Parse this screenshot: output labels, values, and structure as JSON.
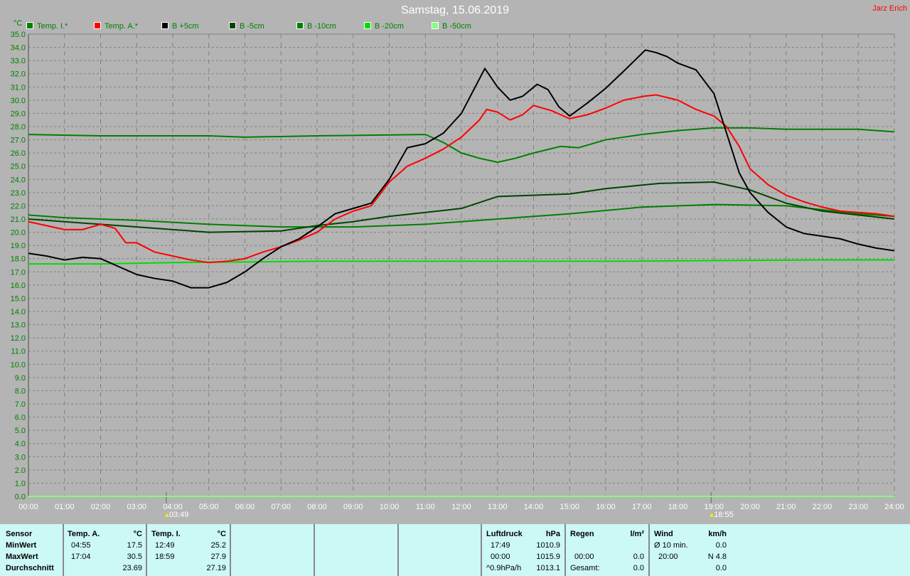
{
  "title": "Samstag, 15.06.2019",
  "author": "Jarz Erich",
  "chart_data": {
    "type": "line",
    "title": "Samstag, 15.06.2019",
    "ylabel": "°C",
    "xlabel": "",
    "ylim": [
      0,
      35
    ],
    "xlim": [
      0,
      24
    ],
    "yticks": [
      "0.0",
      "1.0",
      "2.0",
      "3.0",
      "4.0",
      "5.0",
      "6.0",
      "7.0",
      "8.0",
      "9.0",
      "10.0",
      "11.0",
      "12.0",
      "13.0",
      "14.0",
      "15.0",
      "16.0",
      "17.0",
      "18.0",
      "19.0",
      "20.0",
      "21.0",
      "22.0",
      "23.0",
      "24.0",
      "25.0",
      "26.0",
      "27.0",
      "28.0",
      "29.0",
      "30.0",
      "31.0",
      "32.0",
      "33.0",
      "34.0",
      "35.0"
    ],
    "xticks": [
      "00:00",
      "01:00",
      "02:00",
      "03:00",
      "04:00",
      "05:00",
      "06:00",
      "07:00",
      "08:00",
      "09:00",
      "10:00",
      "11:00",
      "12:00",
      "13:00",
      "14:00",
      "15:00",
      "16:00",
      "17:00",
      "18:00",
      "19:00",
      "20:00",
      "21:00",
      "22:00",
      "23:00",
      "24:00"
    ],
    "grid": true,
    "legend": "top-left",
    "annotations": [
      {
        "label": "03:49",
        "x": 3.82,
        "kind": "sunrise"
      },
      {
        "label": "18:55",
        "x": 18.92,
        "kind": "sunset"
      }
    ],
    "series": [
      {
        "name": "Temp. I.*",
        "color": "#008000",
        "points": [
          [
            0,
            27.4
          ],
          [
            2,
            27.3
          ],
          [
            5,
            27.3
          ],
          [
            6,
            27.2
          ],
          [
            8,
            27.3
          ],
          [
            11,
            27.4
          ],
          [
            11.5,
            26.8
          ],
          [
            12,
            26.0
          ],
          [
            12.5,
            25.6
          ],
          [
            13,
            25.3
          ],
          [
            13.5,
            25.6
          ],
          [
            14,
            26.0
          ],
          [
            14.75,
            26.5
          ],
          [
            15.25,
            26.4
          ],
          [
            16,
            27.0
          ],
          [
            17,
            27.4
          ],
          [
            18,
            27.7
          ],
          [
            19,
            27.9
          ],
          [
            20,
            27.9
          ],
          [
            21,
            27.8
          ],
          [
            22,
            27.8
          ],
          [
            23,
            27.8
          ],
          [
            24,
            27.6
          ]
        ]
      },
      {
        "name": "Temp. A.*",
        "color": "#ff0000",
        "points": [
          [
            0,
            20.8
          ],
          [
            1,
            20.2
          ],
          [
            1.5,
            20.2
          ],
          [
            2,
            20.6
          ],
          [
            2.4,
            20.3
          ],
          [
            2.7,
            19.2
          ],
          [
            3,
            19.2
          ],
          [
            3.5,
            18.5
          ],
          [
            4,
            18.2
          ],
          [
            4.5,
            17.9
          ],
          [
            5,
            17.7
          ],
          [
            5.5,
            17.8
          ],
          [
            6,
            18.0
          ],
          [
            6.5,
            18.5
          ],
          [
            7,
            18.9
          ],
          [
            7.5,
            19.4
          ],
          [
            8,
            20.0
          ],
          [
            8.5,
            21.0
          ],
          [
            9,
            21.6
          ],
          [
            9.5,
            22.0
          ],
          [
            10,
            23.8
          ],
          [
            10.5,
            25.0
          ],
          [
            11,
            25.6
          ],
          [
            11.5,
            26.3
          ],
          [
            12,
            27.2
          ],
          [
            12.5,
            28.5
          ],
          [
            12.7,
            29.3
          ],
          [
            13,
            29.1
          ],
          [
            13.35,
            28.5
          ],
          [
            13.7,
            28.9
          ],
          [
            14,
            29.6
          ],
          [
            14.5,
            29.2
          ],
          [
            15,
            28.6
          ],
          [
            15.5,
            28.9
          ],
          [
            16,
            29.4
          ],
          [
            16.5,
            30.0
          ],
          [
            17.07,
            30.3
          ],
          [
            17.4,
            30.4
          ],
          [
            17.7,
            30.2
          ],
          [
            18,
            30.0
          ],
          [
            18.5,
            29.3
          ],
          [
            19,
            28.8
          ],
          [
            19.35,
            28.0
          ],
          [
            19.7,
            26.5
          ],
          [
            20,
            24.8
          ],
          [
            20.5,
            23.6
          ],
          [
            21,
            22.8
          ],
          [
            21.5,
            22.3
          ],
          [
            22,
            21.9
          ],
          [
            22.5,
            21.6
          ],
          [
            23,
            21.5
          ],
          [
            23.5,
            21.4
          ],
          [
            24,
            21.2
          ]
        ]
      },
      {
        "name": "B +5cm",
        "color": "#000000",
        "points": [
          [
            0,
            18.4
          ],
          [
            0.5,
            18.2
          ],
          [
            1,
            17.9
          ],
          [
            1.5,
            18.1
          ],
          [
            2,
            18.0
          ],
          [
            2.5,
            17.4
          ],
          [
            3,
            16.8
          ],
          [
            3.5,
            16.5
          ],
          [
            4,
            16.3
          ],
          [
            4.5,
            15.8
          ],
          [
            5,
            15.8
          ],
          [
            5.5,
            16.2
          ],
          [
            6,
            17.0
          ],
          [
            6.5,
            18.0
          ],
          [
            7,
            18.9
          ],
          [
            7.5,
            19.5
          ],
          [
            8,
            20.4
          ],
          [
            8.5,
            21.4
          ],
          [
            9,
            21.8
          ],
          [
            9.5,
            22.2
          ],
          [
            10,
            24.0
          ],
          [
            10.5,
            26.4
          ],
          [
            11,
            26.7
          ],
          [
            11.5,
            27.5
          ],
          [
            12,
            29.0
          ],
          [
            12.65,
            32.4
          ],
          [
            13,
            31.0
          ],
          [
            13.35,
            30.0
          ],
          [
            13.7,
            30.3
          ],
          [
            14.1,
            31.2
          ],
          [
            14.4,
            30.8
          ],
          [
            14.7,
            29.5
          ],
          [
            15,
            28.8
          ],
          [
            15.5,
            29.8
          ],
          [
            16,
            30.9
          ],
          [
            16.5,
            32.2
          ],
          [
            17.1,
            33.8
          ],
          [
            17.4,
            33.6
          ],
          [
            17.7,
            33.3
          ],
          [
            18,
            32.8
          ],
          [
            18.5,
            32.3
          ],
          [
            19,
            30.5
          ],
          [
            19.35,
            27.5
          ],
          [
            19.7,
            24.5
          ],
          [
            20,
            23.0
          ],
          [
            20.5,
            21.5
          ],
          [
            21,
            20.4
          ],
          [
            21.5,
            19.9
          ],
          [
            22,
            19.7
          ],
          [
            22.5,
            19.5
          ],
          [
            23,
            19.1
          ],
          [
            23.5,
            18.8
          ],
          [
            24,
            18.6
          ]
        ]
      },
      {
        "name": "B -5cm",
        "color": "#004400",
        "points": [
          [
            0,
            21.0
          ],
          [
            1,
            20.8
          ],
          [
            3,
            20.4
          ],
          [
            5,
            20.0
          ],
          [
            7,
            20.1
          ],
          [
            8,
            20.5
          ],
          [
            9,
            20.8
          ],
          [
            10,
            21.2
          ],
          [
            12,
            21.8
          ],
          [
            13,
            22.7
          ],
          [
            15,
            22.9
          ],
          [
            16,
            23.3
          ],
          [
            17.5,
            23.7
          ],
          [
            19,
            23.8
          ],
          [
            20,
            23.2
          ],
          [
            21,
            22.2
          ],
          [
            22,
            21.6
          ],
          [
            23,
            21.3
          ],
          [
            24,
            21.0
          ]
        ]
      },
      {
        "name": "B -10cm",
        "color": "#008000",
        "points": [
          [
            0,
            21.3
          ],
          [
            1,
            21.1
          ],
          [
            3,
            20.9
          ],
          [
            5,
            20.6
          ],
          [
            7,
            20.4
          ],
          [
            9,
            20.4
          ],
          [
            11,
            20.6
          ],
          [
            13,
            21.0
          ],
          [
            15,
            21.4
          ],
          [
            17,
            21.9
          ],
          [
            19,
            22.1
          ],
          [
            21,
            22.0
          ],
          [
            22,
            21.7
          ],
          [
            23,
            21.4
          ],
          [
            24,
            21.2
          ]
        ]
      },
      {
        "name": "B -20cm",
        "color": "#00dd00",
        "points": [
          [
            0,
            17.6
          ],
          [
            2,
            17.6
          ],
          [
            4,
            17.7
          ],
          [
            8,
            17.8
          ],
          [
            16,
            17.8
          ],
          [
            22,
            17.9
          ],
          [
            24,
            17.9
          ]
        ]
      },
      {
        "name": "B -50cm",
        "color": "#80ff80",
        "points": [
          [
            0,
            0
          ],
          [
            24,
            0
          ]
        ]
      }
    ]
  },
  "table": {
    "sensor": {
      "header": "Sensor",
      "rows": [
        "MinWert",
        "MaxWert",
        "Durchschnitt"
      ]
    },
    "temp_a": {
      "header": "Temp. A.",
      "unit": "°C",
      "min_time": "04:55",
      "min": "17.5",
      "max_time": "17:04",
      "max": "30.5",
      "avg": "23.69"
    },
    "temp_i": {
      "header": "Temp. I.",
      "unit": "°C",
      "min_time": "12:49",
      "min": "25.2",
      "max_time": "18:59",
      "max": "27.9",
      "avg": "27.19"
    },
    "pressure": {
      "header": "Luftdruck",
      "unit": "hPa",
      "r1a": "17:49",
      "r1b": "1010.9",
      "r2a": "00:00",
      "r2b": "1015.9",
      "r3a": "^0.9hPa/h",
      "r3b": "1013.1"
    },
    "rain": {
      "header": "Regen",
      "unit": "l/m²",
      "r2a": "00:00",
      "r2b": "0.0",
      "r3a": "Gesamt:",
      "r3b": "0.0"
    },
    "wind": {
      "header": "Wind",
      "unit": "km/h",
      "r1a": "Ø 10 min.",
      "r1b": "0.0",
      "r2a": "20:00",
      "r2b": "N 4.8",
      "r3b": "0.0"
    }
  }
}
